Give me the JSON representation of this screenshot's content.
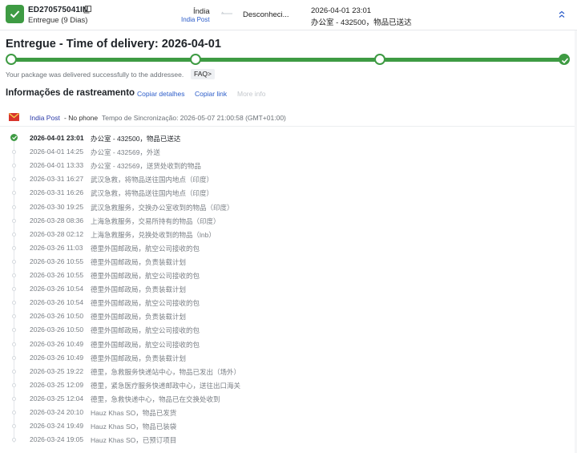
{
  "header": {
    "tracking_number": "ED270575041IN",
    "status_summary": "Entregue (9 Dias)",
    "destination_country": "Índia",
    "destination_carrier": "India Post",
    "origin_country": "Desconheci...",
    "last_event_time": "2026-04-01 23:01",
    "last_event_desc": "办公室 - 432500，物品已送达",
    "icons": {
      "status": "check-icon",
      "copy": "copy-icon",
      "collapse": "chevrons-up-icon"
    },
    "colors": {
      "delivered": "#3e9b43",
      "link": "#2b5cc9"
    }
  },
  "headline": "Entregue - Time of delivery: 2026-04-01",
  "progress": {
    "fraction": 1.0,
    "stages": 4
  },
  "delivered_message": "Your package was delivered successfully to the addressee.",
  "faq_label": "FAQ>",
  "tracking_section": {
    "title": "Informações de rastreamento",
    "copy_details": "Copiar detalhes",
    "copy_link": "Copiar link",
    "more_info": "More info"
  },
  "carrier": {
    "name": "India Post",
    "phone": " - No phone",
    "sync_time": "Tempo de Sincronização: 2026-05-07 21:00:58 (GMT+01:00)"
  },
  "events": [
    {
      "time": "2026-04-01 23:01",
      "desc": "办公室 - 432500，物品已送达"
    },
    {
      "time": "2026-04-01 14:25",
      "desc": "办公室 - 432569，外送"
    },
    {
      "time": "2026-04-01 13:33",
      "desc": "办公室 - 432569，送货处收到的物品"
    },
    {
      "time": "2026-03-31 16:27",
      "desc": "武汉急救，将物品送往国内地点（印度）"
    },
    {
      "time": "2026-03-31 16:26",
      "desc": "武汉急救，将物品送往国内地点（印度）"
    },
    {
      "time": "2026-03-30 19:25",
      "desc": "武汉急救服务，交换办公室收到的物品（印度）"
    },
    {
      "time": "2026-03-28 08:36",
      "desc": "上海急救服务，交易所持有的物品（印度）"
    },
    {
      "time": "2026-03-28 02:12",
      "desc": "上海急救服务，兑换处收到的物品（lnb）"
    },
    {
      "time": "2026-03-26 11:03",
      "desc": "德里外国邮政局，航空公司接收的包"
    },
    {
      "time": "2026-03-26 10:55",
      "desc": "德里外国邮政局，负责装载计划"
    },
    {
      "time": "2026-03-26 10:55",
      "desc": "德里外国邮政局，航空公司接收的包"
    },
    {
      "time": "2026-03-26 10:54",
      "desc": "德里外国邮政局，负责装载计划"
    },
    {
      "time": "2026-03-26 10:54",
      "desc": "德里外国邮政局，航空公司接收的包"
    },
    {
      "time": "2026-03-26 10:50",
      "desc": "德里外国邮政局，负责装载计划"
    },
    {
      "time": "2026-03-26 10:50",
      "desc": "德里外国邮政局，航空公司接收的包"
    },
    {
      "time": "2026-03-26 10:49",
      "desc": "德里外国邮政局，航空公司接收的包"
    },
    {
      "time": "2026-03-26 10:49",
      "desc": "德里外国邮政局，负责装载计划"
    },
    {
      "time": "2026-03-25 19:22",
      "desc": "德里，急救服务快递站中心，物品已发出（场外）"
    },
    {
      "time": "2026-03-25 12:09",
      "desc": "德里，紧急医疗服务快递邮政中心，送往出口海关"
    },
    {
      "time": "2026-03-25 12:04",
      "desc": "德里，急救快递中心，物品已在交换处收到"
    },
    {
      "time": "2026-03-24 20:10",
      "desc": "Hauz Khas SO，物品已发货"
    },
    {
      "time": "2026-03-24 19:49",
      "desc": "Hauz Khas SO，物品已装袋"
    },
    {
      "time": "2026-03-24 19:05",
      "desc": "Hauz Khas SO，已预订项目"
    }
  ]
}
